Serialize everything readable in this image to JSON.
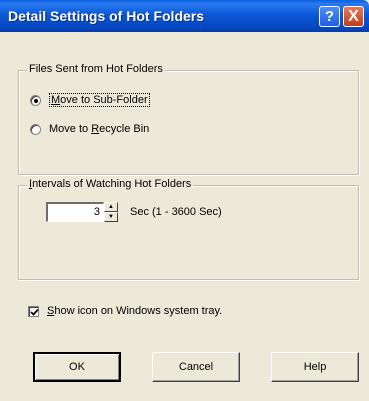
{
  "window": {
    "title": "Detail Settings of Hot Folders",
    "help_glyph": "?",
    "close_glyph": "X"
  },
  "files_group": {
    "label": "Files Sent from Hot Folders",
    "options": [
      {
        "pre": "",
        "mnemonic": "M",
        "post": "ove to Sub-Folder",
        "selected": true
      },
      {
        "pre": "Move to ",
        "mnemonic": "R",
        "post": "ecycle Bin",
        "selected": false
      }
    ]
  },
  "interval_group": {
    "label_mnemonic": "I",
    "label_rest": "ntervals of Watching Hot Folders",
    "value": "3",
    "unit": "Sec (1 - 3600 Sec)"
  },
  "tray_option": {
    "mnemonic": "S",
    "rest": "how icon on Windows system tray.",
    "checked": true
  },
  "buttons": {
    "ok": "OK",
    "cancel": "Cancel",
    "help": "Help"
  },
  "colors": {
    "dialog_bg": "#ece9d8",
    "titlebar_blue": "#0a58d8",
    "close_red": "#c33d18"
  }
}
